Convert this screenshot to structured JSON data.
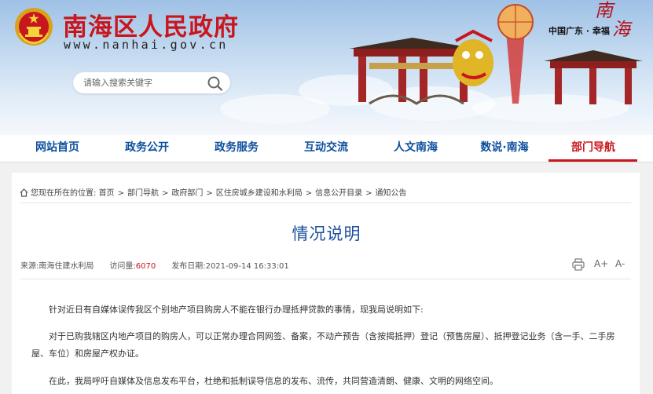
{
  "header": {
    "site_title": "南海区人民政府",
    "site_url": "www.nanhai.gov.cn",
    "slogan": "中国广东 · 幸福",
    "brand_mark": [
      "南",
      "海"
    ]
  },
  "search": {
    "placeholder": "请输入搜索关键字"
  },
  "nav": {
    "items": [
      {
        "label": "网站首页"
      },
      {
        "label": "政务公开"
      },
      {
        "label": "政务服务"
      },
      {
        "label": "互动交流"
      },
      {
        "label": "人文南海"
      },
      {
        "label": "数说·南海"
      },
      {
        "label": "部门导航"
      }
    ],
    "active_index": 6
  },
  "breadcrumb": {
    "prefix": "您现在所在的位置:",
    "items": [
      "首页",
      "部门导航",
      "政府部门",
      "区住房城乡建设和水利局",
      "信息公开目录",
      "通知公告"
    ],
    "separator": ">"
  },
  "article": {
    "title": "情况说明",
    "meta": {
      "source_label": "来源:",
      "source": "南海住建水利局",
      "views_label": "访问量:",
      "views": "6070",
      "date_label": "发布日期:",
      "date": "2021-09-14 16:33:01"
    },
    "paragraphs": [
      "针对近日有自媒体误传我区个别地产项目购房人不能在银行办理抵押贷款的事情，现我局说明如下:",
      "对于已购我辖区内地产项目的购房人，可以正常办理合同网签、备案，不动产预告（含按揭抵押）登记（预售房屋）、抵押登记业务（含一手、二手房屋、车位）和房屋产权办证。",
      "在此，我局呼吁自媒体及信息发布平台，杜绝和抵制误导信息的发布、流传，共同营造清朗、健康、文明的网络空间。"
    ]
  },
  "tools": {
    "print_icon": "print-icon",
    "font_larger_label": "A+",
    "font_smaller_label": "A-"
  },
  "colors": {
    "brand_red": "#c8161d",
    "nav_blue": "#0d4f9e",
    "title_blue": "#1a4f9c"
  }
}
